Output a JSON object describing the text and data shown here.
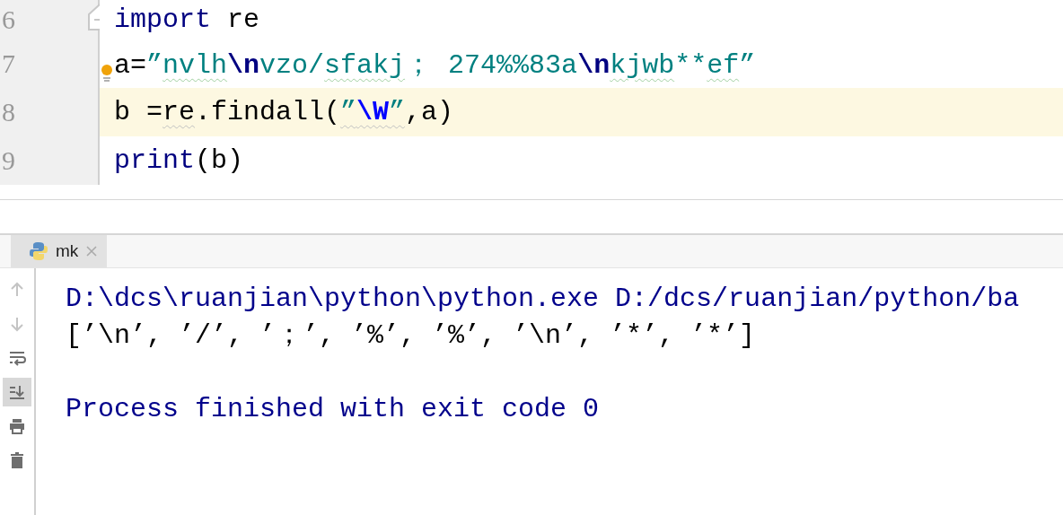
{
  "editor": {
    "lines": [
      {
        "number": "6",
        "current": false,
        "fold_marker": true,
        "bulb": false,
        "tokens": [
          {
            "text": "import",
            "kind": "keyword"
          },
          {
            "text": " re",
            "kind": "plain"
          }
        ]
      },
      {
        "number": "7",
        "current": false,
        "fold_marker": false,
        "bulb": true,
        "tokens": [
          {
            "text": "a=",
            "kind": "plain"
          },
          {
            "text": "”",
            "kind": "string"
          },
          {
            "text": "nvlh",
            "kind": "string",
            "typo": true
          },
          {
            "text": "\\n",
            "kind": "escape"
          },
          {
            "text": "vzo/",
            "kind": "string"
          },
          {
            "text": "sfakj",
            "kind": "string",
            "typo": true
          },
          {
            "text": "； 274%%83a",
            "kind": "string"
          },
          {
            "text": "\\n",
            "kind": "escape"
          },
          {
            "text": "kjwb",
            "kind": "string",
            "typo": true
          },
          {
            "text": "**",
            "kind": "string"
          },
          {
            "text": "ef",
            "kind": "string",
            "typo": true
          },
          {
            "text": "”",
            "kind": "string"
          }
        ]
      },
      {
        "number": "8",
        "current": true,
        "fold_marker": false,
        "bulb": false,
        "tokens": [
          {
            "text": "b =",
            "kind": "plain"
          },
          {
            "text": "re",
            "kind": "plain",
            "weak_warning": true
          },
          {
            "text": ".findall(",
            "kind": "plain"
          },
          {
            "text": "”",
            "kind": "string",
            "weak_warning": true
          },
          {
            "text": "\\W",
            "kind": "regex",
            "weak_warning": true
          },
          {
            "text": "”",
            "kind": "string",
            "weak_warning": true
          },
          {
            "text": ",a)",
            "kind": "plain"
          }
        ]
      },
      {
        "number": "9",
        "current": false,
        "fold_marker": false,
        "bulb": false,
        "tokens": [
          {
            "text": "print",
            "kind": "keyword"
          },
          {
            "text": "(b)",
            "kind": "plain"
          }
        ]
      }
    ]
  },
  "run_panel": {
    "tabs": [
      {
        "label": "mk",
        "selected": true
      }
    ],
    "toolbar": [
      {
        "kind": "up",
        "disabled": true,
        "selected": false
      },
      {
        "kind": "down",
        "disabled": true,
        "selected": false
      },
      {
        "kind": "wrap",
        "disabled": false,
        "selected": false
      },
      {
        "kind": "scroll-end",
        "disabled": false,
        "selected": true
      },
      {
        "kind": "print",
        "disabled": false,
        "selected": false
      },
      {
        "kind": "trash",
        "disabled": false,
        "selected": false
      }
    ],
    "console": [
      {
        "text": "D:\\dcs\\ruanjian\\python\\python.exe D:/dcs/ruanjian/python/ba",
        "kind": "system"
      },
      {
        "text": "[’\\n’, ’/’, ’；’, ’%’, ’%’, ’\\n’, ’*’, ’*’]",
        "kind": "output"
      },
      {
        "kind": "blank"
      },
      {
        "text": "Process finished with exit code 0",
        "kind": "system"
      }
    ]
  }
}
